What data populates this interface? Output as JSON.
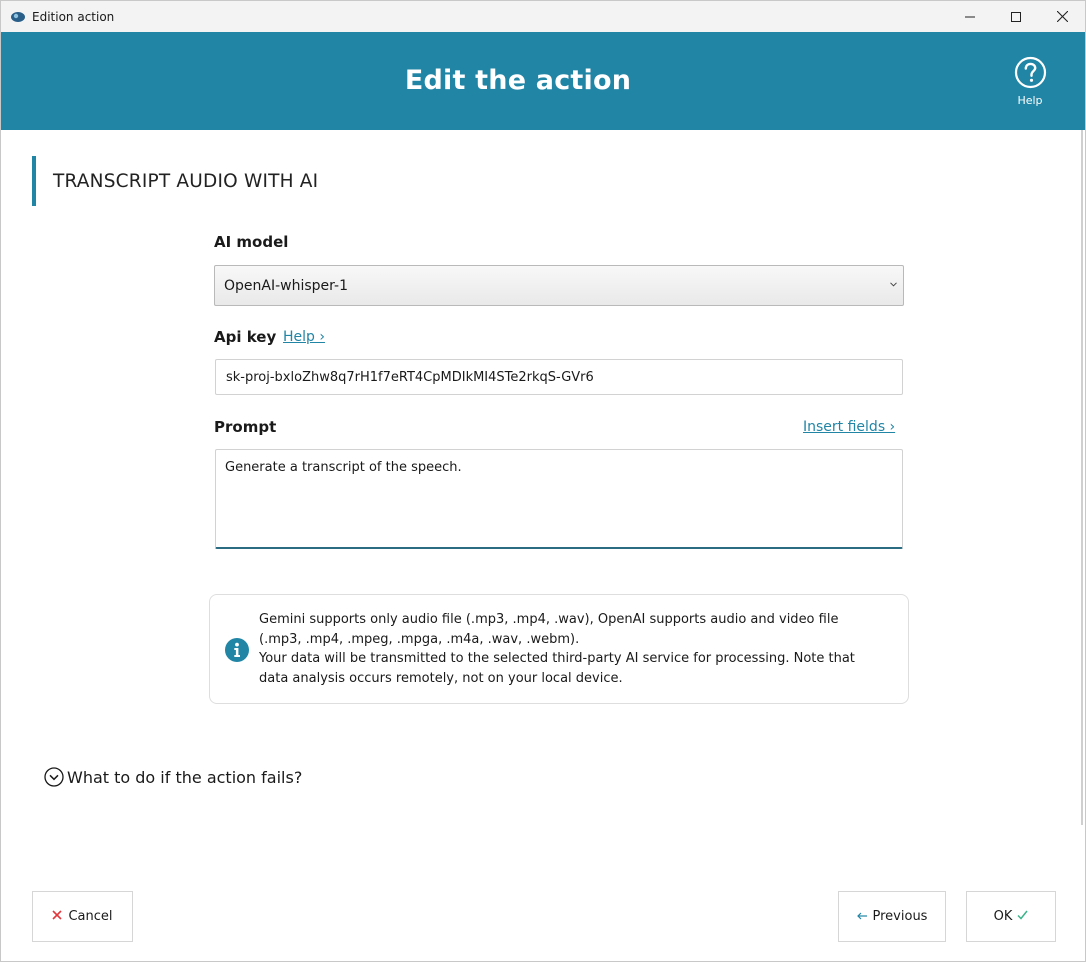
{
  "window": {
    "title": "Edition action"
  },
  "header": {
    "title": "Edit the action",
    "help_label": "Help"
  },
  "section": {
    "title": "TRANSCRIPT AUDIO WITH AI"
  },
  "ai_model": {
    "label": "AI model",
    "selected": "OpenAI-whisper-1"
  },
  "api_key": {
    "label": "Api key",
    "help_link": "Help ›",
    "value": "sk-proj-bxloZhw8q7rH1f7eRT4CpMDIkMI4STe2rkqS-GVr6"
  },
  "prompt": {
    "label": "Prompt",
    "insert_link": "Insert fields ›",
    "value": "Generate a transcript of the speech."
  },
  "info": {
    "line1": "Gemini supports only audio file (.mp3, .mp4, .wav), OpenAI supports audio and video file",
    "line2": "(.mp3, .mp4, .mpeg, .mpga, .m4a, .wav, .webm).",
    "line3": "Your data will be transmitted to the selected third-party AI service for processing. Note that",
    "line4": "data analysis occurs remotely, not on your local device."
  },
  "fail_section": {
    "label": "What to do if the action fails?"
  },
  "buttons": {
    "cancel": "Cancel",
    "previous": "Previous",
    "ok": "OK"
  },
  "colors": {
    "accent": "#2185a6",
    "cancel_icon": "#e0383e",
    "ok_icon": "#3bb38b"
  }
}
